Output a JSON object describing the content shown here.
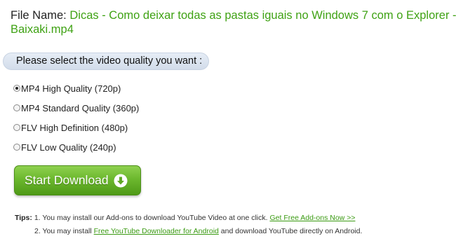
{
  "file": {
    "label": "File Name:",
    "name_line1": "Dicas - Como deixar todas as pastas iguais no Windows 7 com o Explorer -",
    "name_line2": "Baixaki.mp4"
  },
  "quality": {
    "heading": "Please select the video quality you want :",
    "options": [
      {
        "label": "MP4 High Quality (720p)",
        "selected": true
      },
      {
        "label": "MP4 Standard Quality (360p)",
        "selected": false
      },
      {
        "label": "FLV High Definition (480p)",
        "selected": false
      },
      {
        "label": "FLV Low Quality (240p)",
        "selected": false
      }
    ]
  },
  "download": {
    "label": "Start Download",
    "icon": "arrow-down-circle-icon",
    "color": "#6cb82e"
  },
  "tips": {
    "title": "Tips:",
    "tip1_prefix": "1. You may install our Add-ons to download YouTube Video at one click.",
    "tip1_link": "Get Free Add-ons Now >>",
    "tip2_prefix": "2. You may install",
    "tip2_link": "Free YouTube Downloader for Android",
    "tip2_suffix": "and download YouTube directly on Android."
  },
  "colors": {
    "accent_green": "#3fa214",
    "link_green": "#3a9a12"
  }
}
